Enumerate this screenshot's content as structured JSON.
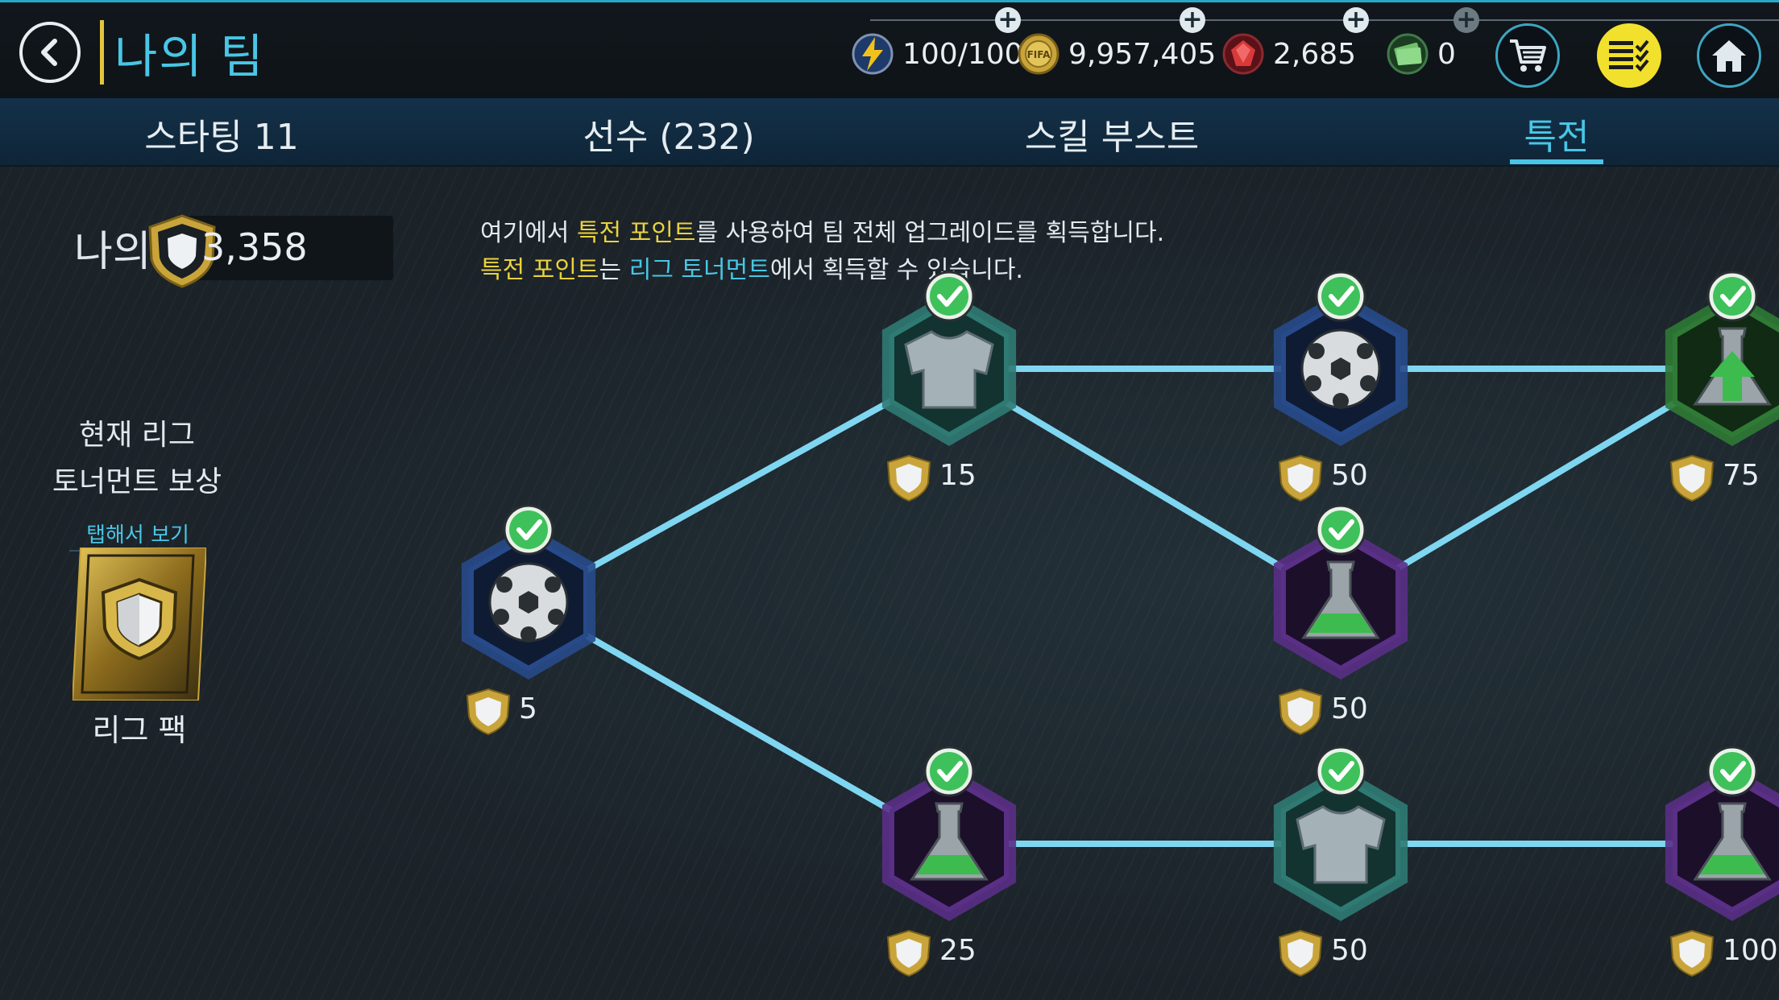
{
  "header": {
    "title": "나의 팀",
    "energy": "100/100",
    "coins": "9,957,405",
    "gems": "2,685",
    "cash": "0"
  },
  "tabs": [
    {
      "label": "스타팅 11",
      "active": false
    },
    {
      "label": "선수 (232)",
      "active": false
    },
    {
      "label": "스킬 부스트",
      "active": false
    },
    {
      "label": "특전",
      "active": true
    }
  ],
  "points": {
    "label": "나의 특전",
    "value": "3,358"
  },
  "description": {
    "line1_a": "여기에서 ",
    "line1_hl": "특전 포인트",
    "line1_b": "를 사용하여 팀 전체 업그레이드를 획득합니다.",
    "line2_hl1": "특전 포인트",
    "line2_a": "는 ",
    "line2_hl2": "리그 토너먼트",
    "line2_b": "에서 획득할 수 있습니다."
  },
  "reward": {
    "title_line1": "현재 리그",
    "title_line2": "토너먼트 보상",
    "tap_label": "탭해서 보기",
    "pack_label": "리그 팩"
  },
  "perk_nodes": [
    {
      "id": "n1",
      "icon": "soccer-ball-icon",
      "frame": "blue",
      "cost": "5",
      "unlocked": true
    },
    {
      "id": "n2",
      "icon": "jersey-icon",
      "frame": "teal",
      "cost": "15",
      "unlocked": true
    },
    {
      "id": "n3",
      "icon": "potion-icon",
      "frame": "purple",
      "cost": "25",
      "unlocked": true
    },
    {
      "id": "n4",
      "icon": "soccer-ball-icon",
      "frame": "blue",
      "cost": "50",
      "unlocked": true
    },
    {
      "id": "n5",
      "icon": "potion-icon",
      "frame": "purple",
      "cost": "50",
      "unlocked": true
    },
    {
      "id": "n6",
      "icon": "jersey-icon",
      "frame": "teal",
      "cost": "50",
      "unlocked": true
    },
    {
      "id": "n7",
      "icon": "potion-arrow-icon",
      "frame": "green",
      "cost": "75",
      "unlocked": true
    },
    {
      "id": "n8",
      "icon": "potion-icon",
      "frame": "purple",
      "cost": "100",
      "unlocked": true
    }
  ],
  "colors": {
    "accent": "#49c6e5",
    "highlight": "#e9d23e",
    "connector": "#7fd6f0",
    "check": "#3ec15a",
    "frame_blue": "#274a8a",
    "frame_teal": "#2f7a73",
    "frame_purple": "#5a2f86",
    "frame_green": "#2f7a35"
  }
}
